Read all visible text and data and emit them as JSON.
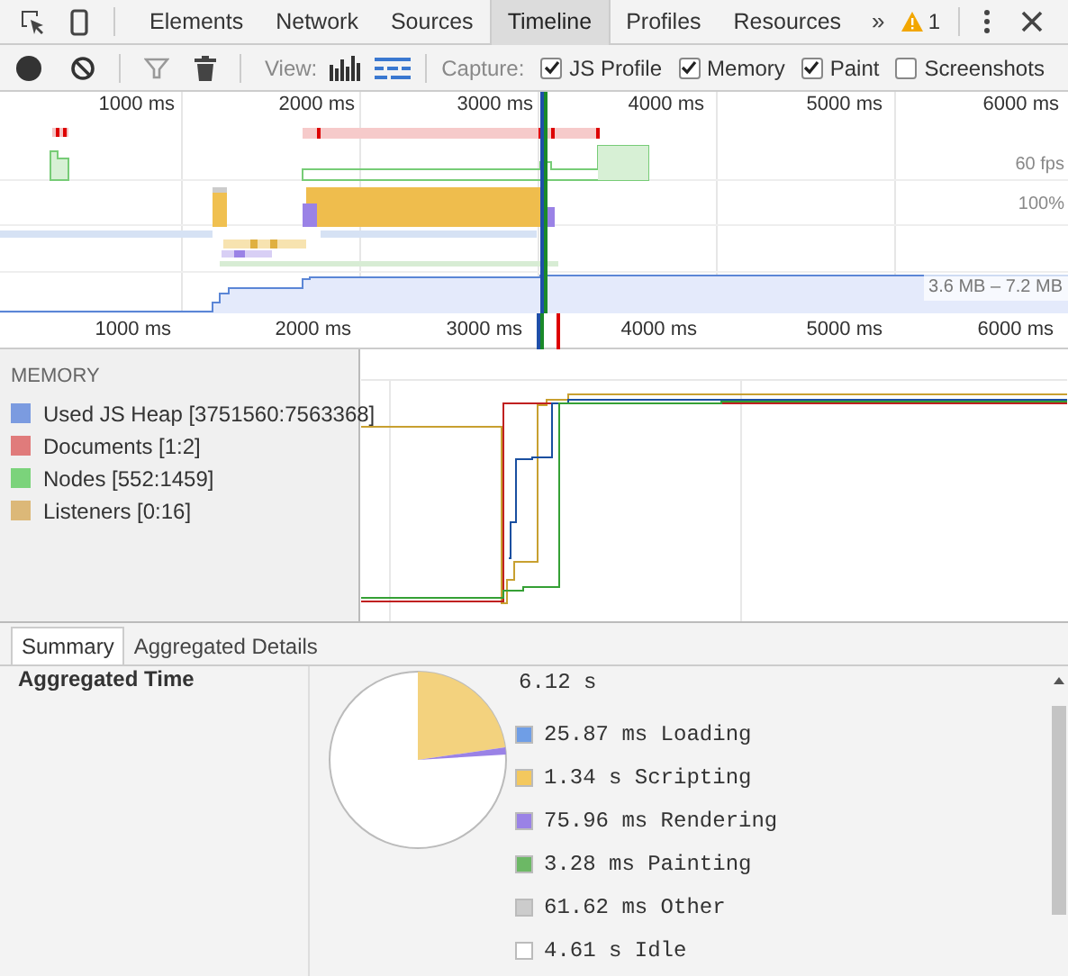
{
  "tabs": [
    {
      "label": "Elements",
      "selected": false
    },
    {
      "label": "Network",
      "selected": false
    },
    {
      "label": "Sources",
      "selected": false
    },
    {
      "label": "Timeline",
      "selected": true
    },
    {
      "label": "Profiles",
      "selected": false
    },
    {
      "label": "Resources",
      "selected": false
    }
  ],
  "more_tabs": "»",
  "warning_count": "1",
  "toolbar": {
    "view_label": "View:",
    "capture_label": "Capture:",
    "capture_options": [
      {
        "label": "JS Profile",
        "checked": true
      },
      {
        "label": "Memory",
        "checked": true
      },
      {
        "label": "Paint",
        "checked": true
      },
      {
        "label": "Screenshots",
        "checked": false
      }
    ]
  },
  "overview": {
    "ticks": [
      "1000 ms",
      "2000 ms",
      "3000 ms",
      "4000 ms",
      "5000 ms",
      "6000 ms"
    ],
    "fps_label": "60 fps",
    "cpu_label": "100%",
    "memory_range": "3.6 MB – 7.2 MB"
  },
  "ruler": {
    "ticks": [
      "1000 ms",
      "2000 ms",
      "3000 ms",
      "4000 ms",
      "5000 ms",
      "6000 ms"
    ]
  },
  "memory": {
    "title": "MEMORY",
    "counters": [
      {
        "label": "Used JS Heap [3751560:7563368]",
        "color": "#7b9be0"
      },
      {
        "label": "Documents [1:2]",
        "color": "#e07b7b"
      },
      {
        "label": "Nodes [552:1459]",
        "color": "#7bd37b"
      },
      {
        "label": "Listeners [0:16]",
        "color": "#dcb878"
      }
    ]
  },
  "details_tabs": [
    {
      "label": "Summary",
      "selected": true
    },
    {
      "label": "Aggregated Details",
      "selected": false
    }
  ],
  "summary": {
    "heading": "Aggregated Time",
    "total": "6.12 s",
    "items": [
      {
        "label": "25.87 ms Loading",
        "color": "#6f9ee6"
      },
      {
        "label": "1.34 s Scripting",
        "color": "#f3c85e"
      },
      {
        "label": "75.96 ms Rendering",
        "color": "#9a82e6"
      },
      {
        "label": "3.28 ms Painting",
        "color": "#6cb865"
      },
      {
        "label": "61.62 ms Other",
        "color": "#cccccc"
      },
      {
        "label": "4.61 s Idle",
        "color": "#ffffff"
      }
    ]
  }
}
